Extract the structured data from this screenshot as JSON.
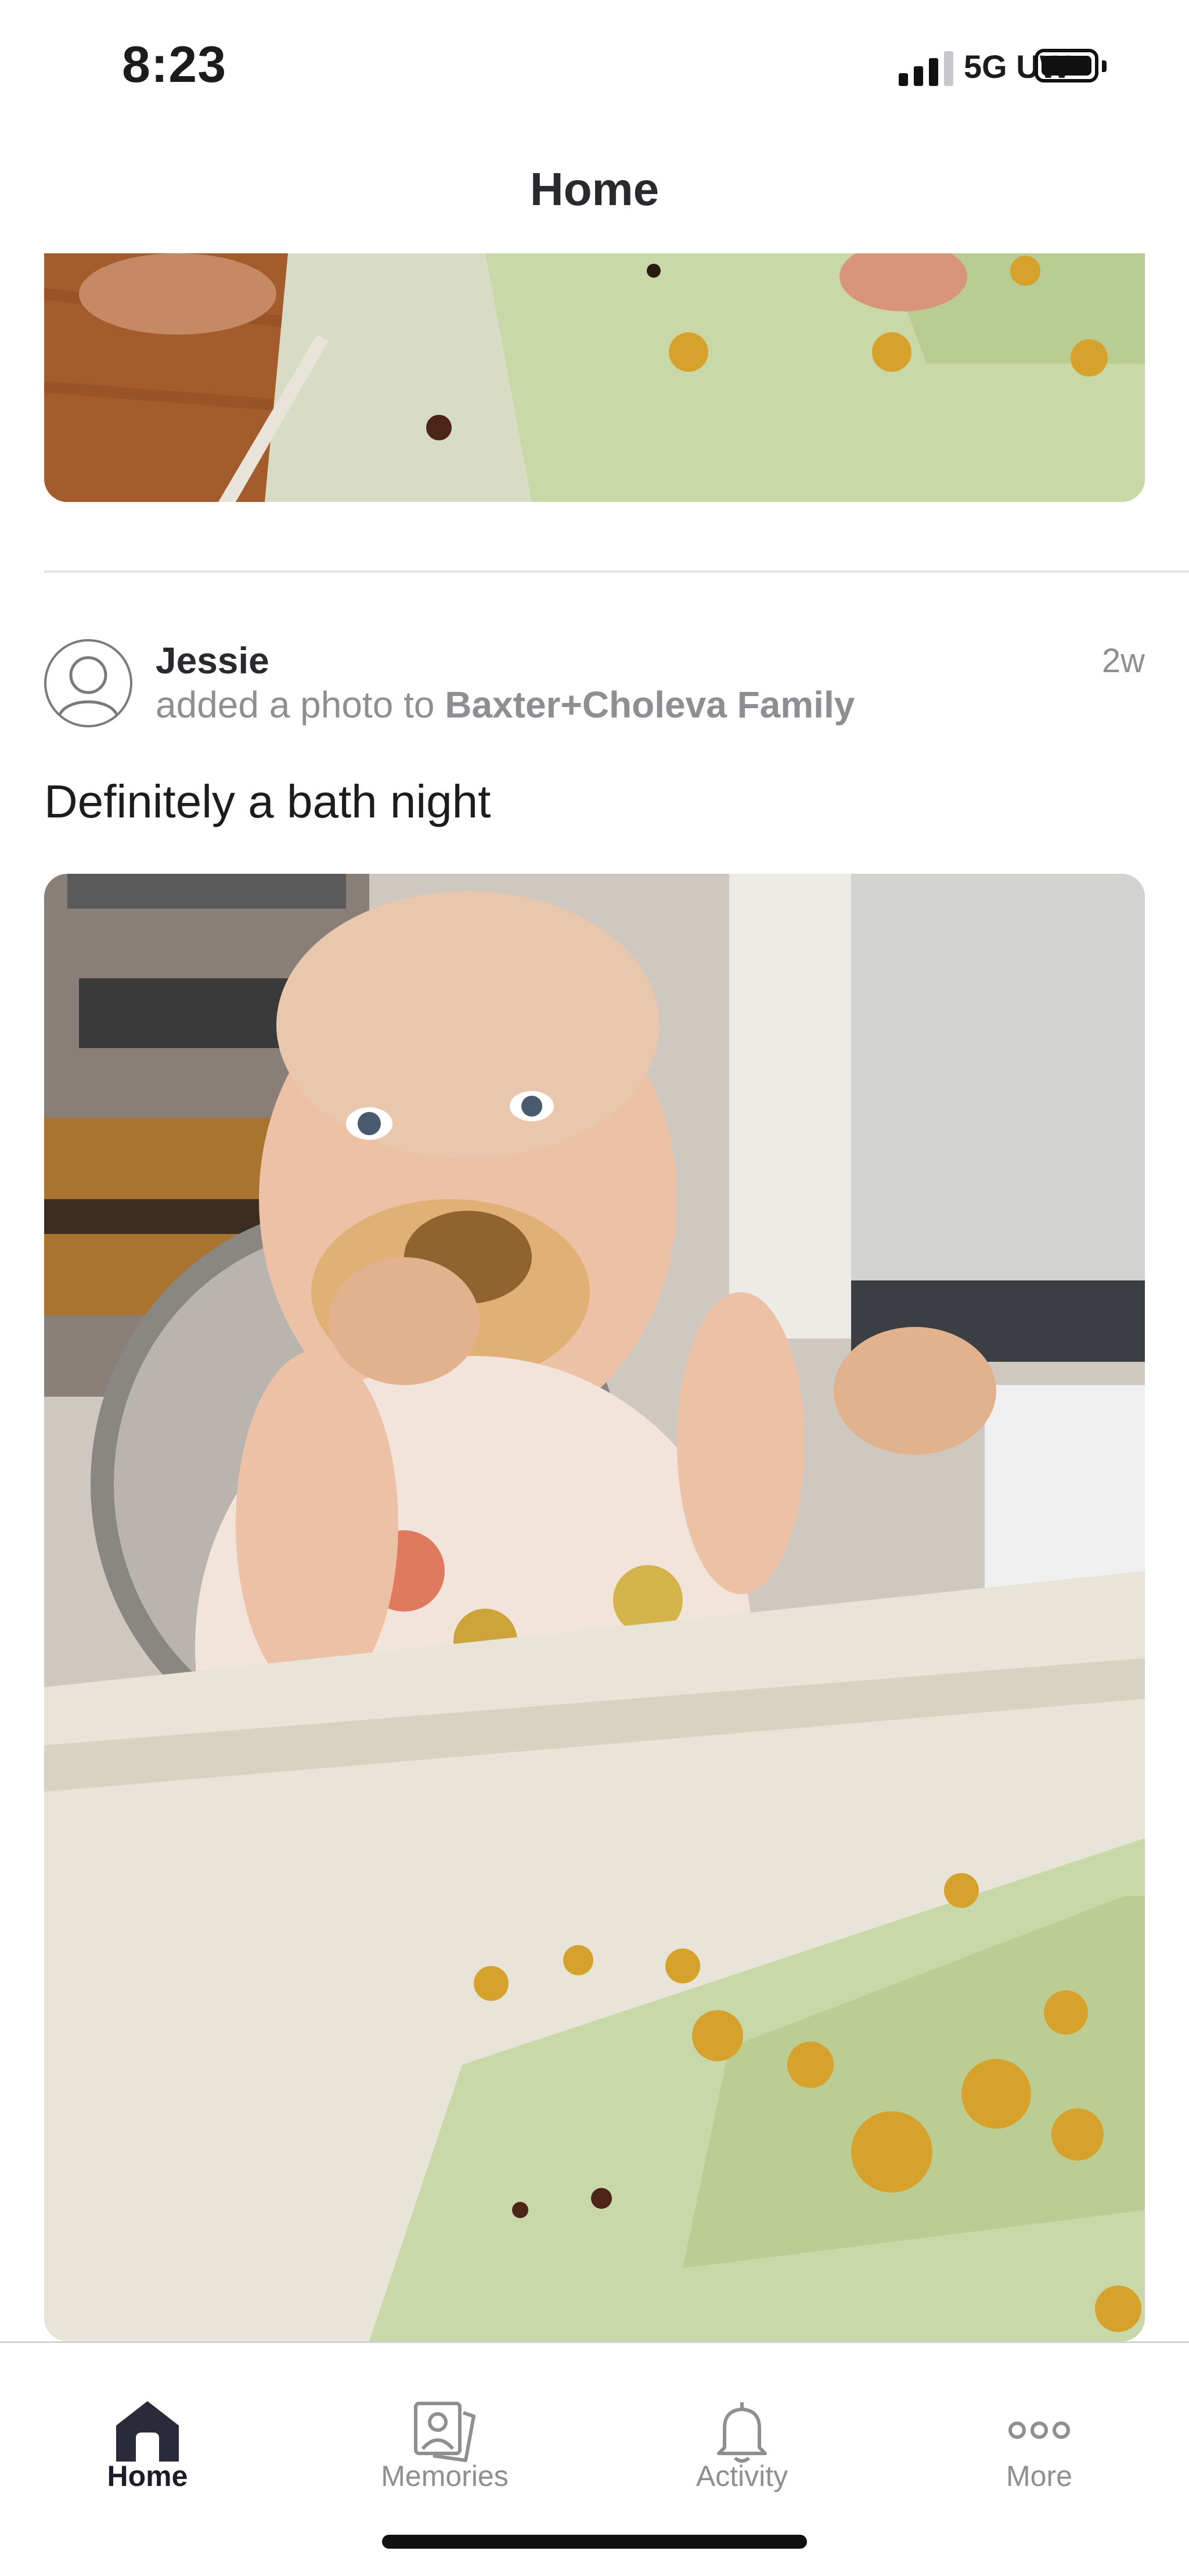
{
  "status_bar": {
    "time": "8:23",
    "network": "5G UW"
  },
  "header": {
    "title": "Home"
  },
  "post": {
    "author": "Jessie",
    "action_prefix": "added a photo to",
    "group": "Baxter+Choleva Family",
    "time_ago": "2w",
    "caption": "Definitely a bath night"
  },
  "tabbar": {
    "tabs": [
      {
        "label": "Home",
        "icon": "home-icon",
        "active": true
      },
      {
        "label": "Memories",
        "icon": "memories-icon",
        "active": false
      },
      {
        "label": "Activity",
        "icon": "bell-icon",
        "active": false
      },
      {
        "label": "More",
        "icon": "more-dots-icon",
        "active": false
      }
    ]
  },
  "colors": {
    "accent": "#2a2a3a",
    "muted": "#8e8e93",
    "tray_green": "#c9d8a8"
  }
}
